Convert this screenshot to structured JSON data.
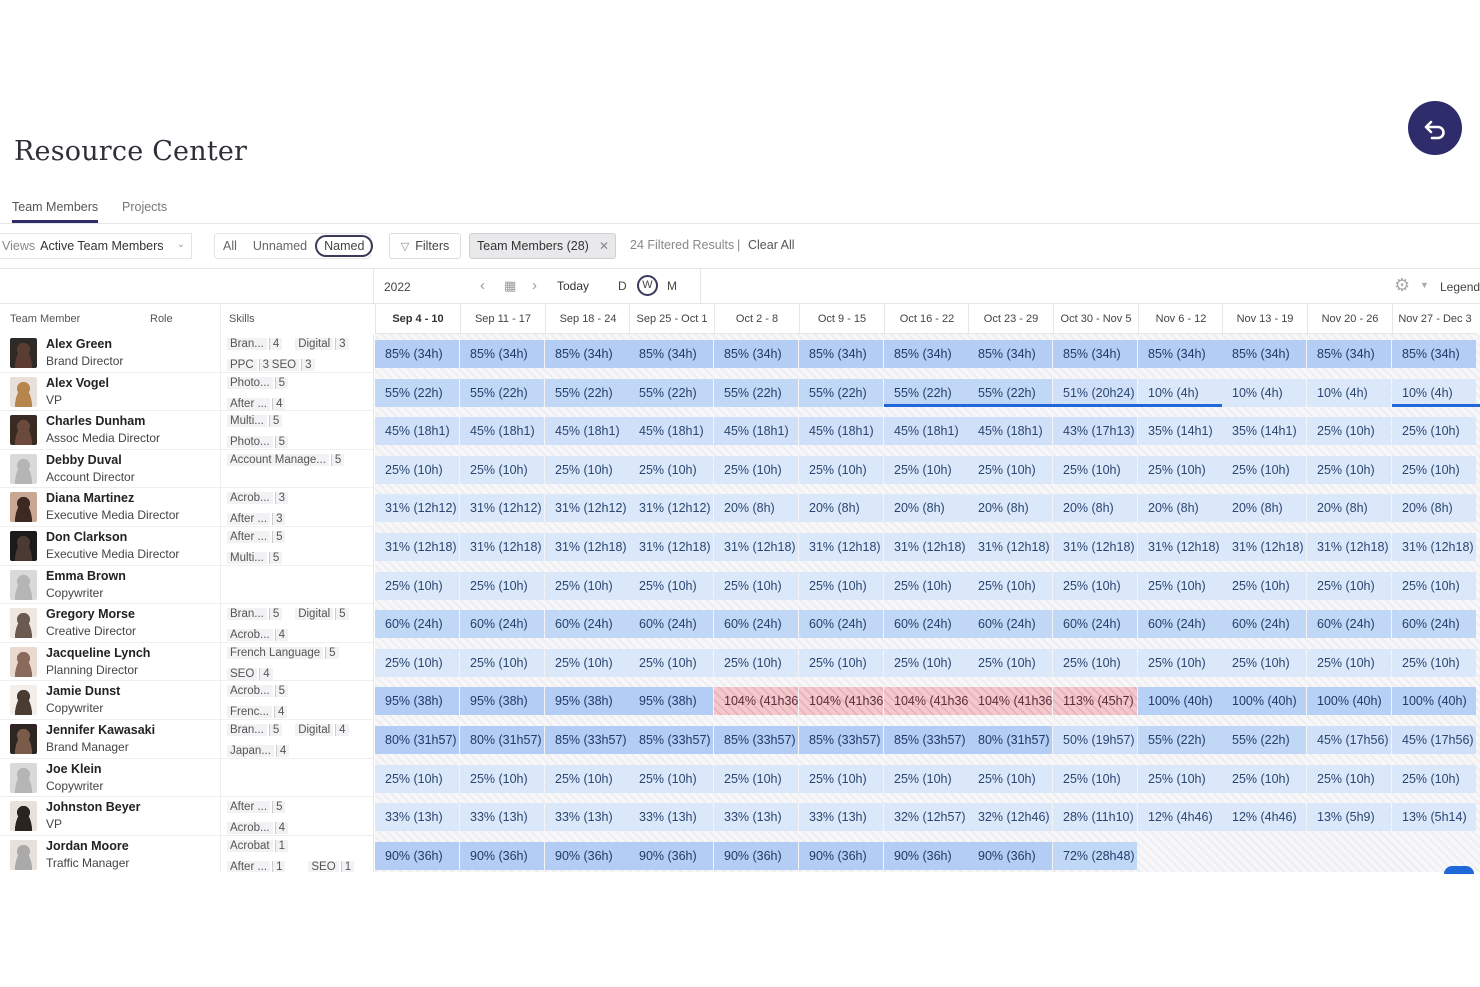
{
  "page": {
    "title": "Resource Center"
  },
  "tabs": [
    {
      "label": "Team Members",
      "active": true
    },
    {
      "label": "Projects",
      "active": false
    }
  ],
  "filterbar": {
    "views_label": "Views",
    "views_value": "Active Team Members",
    "segments": [
      "All",
      "Unnamed",
      "Named"
    ],
    "selected_segment": "Named",
    "filters_label": "Filters",
    "chip_label": "Team Members (28)",
    "filtered_results": "24 Filtered Results",
    "separator": "|",
    "clear_all": "Clear All"
  },
  "timeline": {
    "year": "2022",
    "today": "Today",
    "zoom": [
      "D",
      "W",
      "M"
    ],
    "zoom_selected": "W",
    "legend": "Legend",
    "weeks": [
      "Sep 4 - 10",
      "Sep 11 - 17",
      "Sep 18 - 24",
      "Sep 25 - Oct 1",
      "Oct 2 - 8",
      "Oct 9 - 15",
      "Oct 16 - 22",
      "Oct 23 - 29",
      "Oct 30 - Nov 5",
      "Nov 6 - 12",
      "Nov 13 - 19",
      "Nov 20 - 26",
      "Nov 27 - Dec 3"
    ]
  },
  "columns": {
    "member": "Team Member",
    "role": "Role",
    "skills": "Skills"
  },
  "colors": {
    "brand": "#2f2c6b",
    "accent": "#2067d9",
    "over": "#f2c7cc",
    "full": "#b9d3f7"
  },
  "members": [
    {
      "name": "Alex Green",
      "role": "Brand Director",
      "skills": [
        [
          "Bran...",
          "4"
        ],
        [
          "Digital",
          "3"
        ],
        [
          "PPC",
          "3"
        ],
        [
          "SEO",
          "3"
        ]
      ],
      "cells": [
        "85% (34h)",
        "85% (34h)",
        "85% (34h)",
        "85% (34h)",
        "85% (34h)",
        "85% (34h)",
        "85% (34h)",
        "85% (34h)",
        "85% (34h)",
        "85% (34h)",
        "85% (34h)",
        "85% (34h)",
        "85% (34h)"
      ]
    },
    {
      "name": "Alex Vogel",
      "role": "VP",
      "skills": [
        [
          "Photo...",
          "5"
        ],
        [
          "After ...",
          "4"
        ]
      ],
      "cells": [
        "55% (22h)",
        "55% (22h)",
        "55% (22h)",
        "55% (22h)",
        "55% (22h)",
        "55% (22h)",
        "55% (22h)",
        "55% (22h)",
        "51% (20h24)",
        "10% (4h)",
        "10% (4h)",
        "10% (4h)",
        "10% (4h)"
      ]
    },
    {
      "name": "Charles Dunham",
      "role": "Assoc Media Director",
      "skills": [
        [
          "Multi...",
          "5"
        ],
        [
          "Photo...",
          "5"
        ]
      ],
      "cells": [
        "45% (18h1)",
        "45% (18h1)",
        "45% (18h1)",
        "45% (18h1)",
        "45% (18h1)",
        "45% (18h1)",
        "45% (18h1)",
        "45% (18h1)",
        "43% (17h13)",
        "35% (14h1)",
        "35% (14h1)",
        "25% (10h)",
        "25% (10h)"
      ]
    },
    {
      "name": "Debby Duval",
      "role": "Account Director",
      "skills": [
        [
          "Account Manage...",
          "5"
        ]
      ],
      "cells": [
        "25% (10h)",
        "25% (10h)",
        "25% (10h)",
        "25% (10h)",
        "25% (10h)",
        "25% (10h)",
        "25% (10h)",
        "25% (10h)",
        "25% (10h)",
        "25% (10h)",
        "25% (10h)",
        "25% (10h)",
        "25% (10h)"
      ]
    },
    {
      "name": "Diana Martinez",
      "role": "Executive Media Director",
      "skills": [
        [
          "Acrob...",
          "3"
        ],
        [
          "After ...",
          "3"
        ]
      ],
      "cells": [
        "31% (12h12)",
        "31% (12h12)",
        "31% (12h12)",
        "31% (12h12)",
        "20% (8h)",
        "20% (8h)",
        "20% (8h)",
        "20% (8h)",
        "20% (8h)",
        "20% (8h)",
        "20% (8h)",
        "20% (8h)",
        "20% (8h)"
      ]
    },
    {
      "name": "Don Clarkson",
      "role": "Executive Media Director",
      "skills": [
        [
          "After ...",
          "5"
        ],
        [
          "Multi...",
          "5"
        ]
      ],
      "cells": [
        "31% (12h18)",
        "31% (12h18)",
        "31% (12h18)",
        "31% (12h18)",
        "31% (12h18)",
        "31% (12h18)",
        "31% (12h18)",
        "31% (12h18)",
        "31% (12h18)",
        "31% (12h18)",
        "31% (12h18)",
        "31% (12h18)",
        "31% (12h18)"
      ]
    },
    {
      "name": "Emma Brown",
      "role": "Copywriter",
      "skills": [],
      "cells": [
        "25% (10h)",
        "25% (10h)",
        "25% (10h)",
        "25% (10h)",
        "25% (10h)",
        "25% (10h)",
        "25% (10h)",
        "25% (10h)",
        "25% (10h)",
        "25% (10h)",
        "25% (10h)",
        "25% (10h)",
        "25% (10h)"
      ]
    },
    {
      "name": "Gregory Morse",
      "role": "Creative Director",
      "skills": [
        [
          "Bran...",
          "5"
        ],
        [
          "Digital",
          "5"
        ],
        [
          "Acrob...",
          "4"
        ]
      ],
      "cells": [
        "60% (24h)",
        "60% (24h)",
        "60% (24h)",
        "60% (24h)",
        "60% (24h)",
        "60% (24h)",
        "60% (24h)",
        "60% (24h)",
        "60% (24h)",
        "60% (24h)",
        "60% (24h)",
        "60% (24h)",
        "60% (24h)"
      ]
    },
    {
      "name": "Jacqueline Lynch",
      "role": "Planning Director",
      "skills": [
        [
          "French Language",
          "5"
        ],
        [
          "SEO",
          "4"
        ]
      ],
      "cells": [
        "25% (10h)",
        "25% (10h)",
        "25% (10h)",
        "25% (10h)",
        "25% (10h)",
        "25% (10h)",
        "25% (10h)",
        "25% (10h)",
        "25% (10h)",
        "25% (10h)",
        "25% (10h)",
        "25% (10h)",
        "25% (10h)"
      ]
    },
    {
      "name": "Jamie Dunst",
      "role": "Copywriter",
      "skills": [
        [
          "Acrob...",
          "5"
        ],
        [
          "Frenc...",
          "4"
        ]
      ],
      "cells": [
        "95% (38h)",
        "95% (38h)",
        "95% (38h)",
        "95% (38h)",
        "104% (41h36",
        "104% (41h36",
        "104% (41h36",
        "104% (41h36",
        "113% (45h7)",
        "100% (40h)",
        "100% (40h)",
        "100% (40h)",
        "100% (40h)"
      ]
    },
    {
      "name": "Jennifer Kawasaki",
      "role": "Brand Manager",
      "skills": [
        [
          "Bran...",
          "5"
        ],
        [
          "Digital",
          "4"
        ],
        [
          "Japan...",
          "4"
        ]
      ],
      "cells": [
        "80% (31h57)",
        "80% (31h57)",
        "85% (33h57)",
        "85% (33h57)",
        "85% (33h57)",
        "85% (33h57)",
        "85% (33h57)",
        "80% (31h57)",
        "50% (19h57)",
        "55% (22h)",
        "55% (22h)",
        "45% (17h56)",
        "45% (17h56)"
      ]
    },
    {
      "name": "Joe Klein",
      "role": "Copywriter",
      "skills": [],
      "cells": [
        "25% (10h)",
        "25% (10h)",
        "25% (10h)",
        "25% (10h)",
        "25% (10h)",
        "25% (10h)",
        "25% (10h)",
        "25% (10h)",
        "25% (10h)",
        "25% (10h)",
        "25% (10h)",
        "25% (10h)",
        "25% (10h)"
      ]
    },
    {
      "name": "Johnston Beyer",
      "role": "VP",
      "skills": [
        [
          "After ...",
          "5"
        ],
        [
          "Acrob...",
          "4"
        ]
      ],
      "cells": [
        "33% (13h)",
        "33% (13h)",
        "33% (13h)",
        "33% (13h)",
        "33% (13h)",
        "33% (13h)",
        "32% (12h57)",
        "32% (12h46)",
        "28% (11h10)",
        "12% (4h46)",
        "12% (4h46)",
        "13% (5h9)",
        "13% (5h14)"
      ]
    },
    {
      "name": "Jordan Moore",
      "role": "Traffic Manager",
      "skills": [
        [
          "Acrobat",
          "1"
        ],
        [
          "After ...",
          "1"
        ],
        [
          "SEO",
          "1"
        ]
      ],
      "cells": [
        "90% (36h)",
        "90% (36h)",
        "90% (36h)",
        "90% (36h)",
        "90% (36h)",
        "90% (36h)",
        "90% (36h)",
        "90% (36h)",
        "72% (28h48)",
        "",
        "",
        "",
        ""
      ]
    }
  ]
}
